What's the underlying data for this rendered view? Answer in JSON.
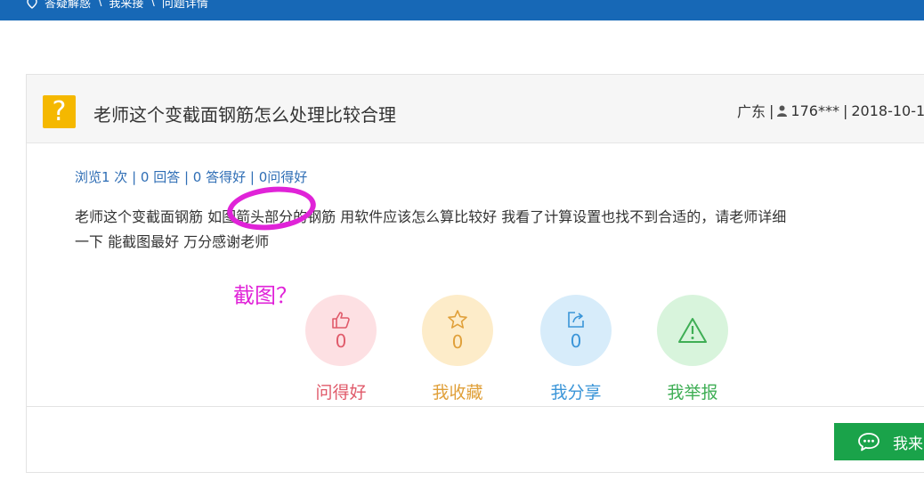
{
  "breadcrumb": {
    "home": "答疑解惑",
    "sep1": "\\",
    "level2": "我来接",
    "sep2": "\\",
    "current": "问题详情"
  },
  "question": {
    "title": "老师这个变截面钢筋怎么处理比较合理",
    "region": "广东",
    "user": "176***",
    "date": "2018-10-1",
    "sep": "|",
    "stats": "浏览1 次 | 0 回答 | 0 答得好 | 0问得好",
    "content_line1": "老师这个变截面钢筋  如图箭头部分的钢筋  用软件应该怎么算比较好  我看了计算设置也找不到合适的，请老师详细",
    "content_line2": "一下  能截图最好  万分感谢老师"
  },
  "annotation": {
    "text": "截图？",
    "color": "#e023d8"
  },
  "actions": [
    {
      "label": "问得好",
      "count": "0",
      "icon": "thumbs-up-icon",
      "color": "#e05a6a",
      "bg": "#fde0e3"
    },
    {
      "label": "我收藏",
      "count": "0",
      "icon": "star-icon",
      "color": "#e0a03a",
      "bg": "#fdecc9"
    },
    {
      "label": "我分享",
      "count": "0",
      "icon": "share-icon",
      "color": "#3a95d8",
      "bg": "#d7ecfa"
    },
    {
      "label": "我举报",
      "count": "",
      "icon": "warning-icon",
      "color": "#3fae55",
      "bg": "#d8f4dc"
    }
  ],
  "answer_button": {
    "label": "我来",
    "icon": "chat-bubble-icon",
    "color": "#1aa34a"
  },
  "colors": {
    "topbar": "#1768b6",
    "link": "#2f6eb5",
    "question_icon": "#f5b800"
  }
}
